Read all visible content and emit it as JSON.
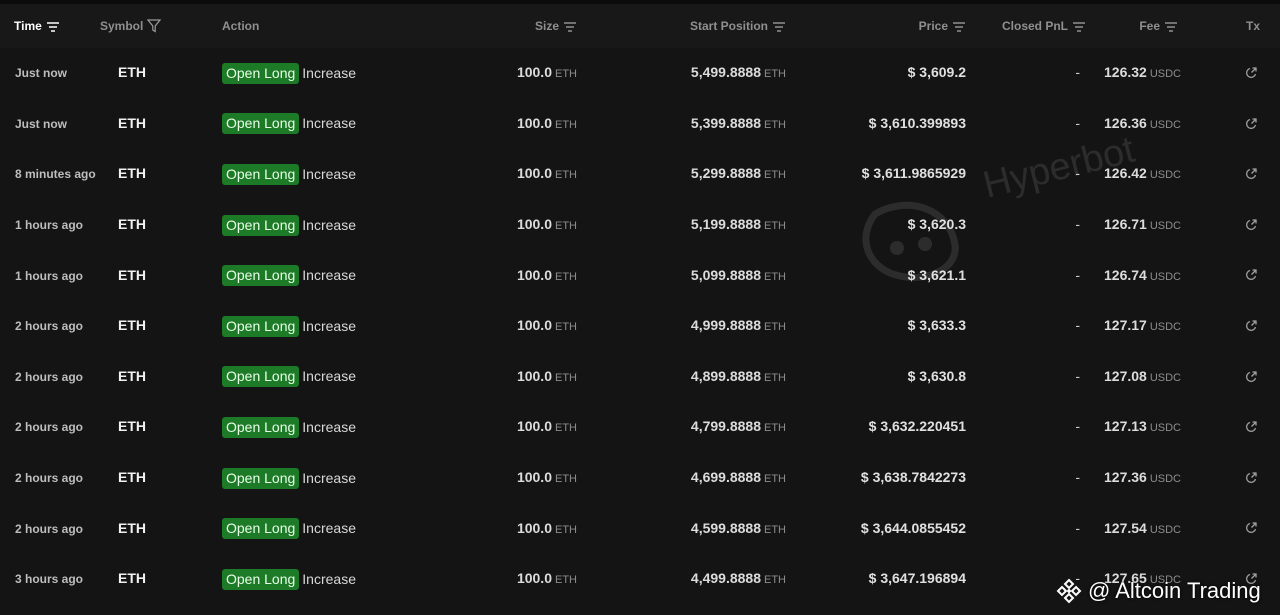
{
  "columns": {
    "time": "Time",
    "symbol": "Symbol",
    "action": "Action",
    "size": "Size",
    "start_position": "Start Position",
    "price": "Price",
    "closed_pnl": "Closed PnL",
    "fee": "Fee",
    "tx": "Tx"
  },
  "units": {
    "eth": "ETH",
    "usdc": "USDC"
  },
  "rows": [
    {
      "time": "Just now",
      "symbol": "ETH",
      "action": "Open Long",
      "detail": "Increase",
      "size": "100.0",
      "start_position": "5,499.8888",
      "price": "$ 3,609.2",
      "closed_pnl": "-",
      "fee": "126.32"
    },
    {
      "time": "Just now",
      "symbol": "ETH",
      "action": "Open Long",
      "detail": "Increase",
      "size": "100.0",
      "start_position": "5,399.8888",
      "price": "$ 3,610.399893",
      "closed_pnl": "-",
      "fee": "126.36"
    },
    {
      "time": "8 minutes ago",
      "symbol": "ETH",
      "action": "Open Long",
      "detail": "Increase",
      "size": "100.0",
      "start_position": "5,299.8888",
      "price": "$ 3,611.9865929",
      "closed_pnl": "-",
      "fee": "126.42"
    },
    {
      "time": "1 hours ago",
      "symbol": "ETH",
      "action": "Open Long",
      "detail": "Increase",
      "size": "100.0",
      "start_position": "5,199.8888",
      "price": "$ 3,620.3",
      "closed_pnl": "-",
      "fee": "126.71"
    },
    {
      "time": "1 hours ago",
      "symbol": "ETH",
      "action": "Open Long",
      "detail": "Increase",
      "size": "100.0",
      "start_position": "5,099.8888",
      "price": "$ 3,621.1",
      "closed_pnl": "-",
      "fee": "126.74"
    },
    {
      "time": "2 hours ago",
      "symbol": "ETH",
      "action": "Open Long",
      "detail": "Increase",
      "size": "100.0",
      "start_position": "4,999.8888",
      "price": "$ 3,633.3",
      "closed_pnl": "-",
      "fee": "127.17"
    },
    {
      "time": "2 hours ago",
      "symbol": "ETH",
      "action": "Open Long",
      "detail": "Increase",
      "size": "100.0",
      "start_position": "4,899.8888",
      "price": "$ 3,630.8",
      "closed_pnl": "-",
      "fee": "127.08"
    },
    {
      "time": "2 hours ago",
      "symbol": "ETH",
      "action": "Open Long",
      "detail": "Increase",
      "size": "100.0",
      "start_position": "4,799.8888",
      "price": "$ 3,632.220451",
      "closed_pnl": "-",
      "fee": "127.13"
    },
    {
      "time": "2 hours ago",
      "symbol": "ETH",
      "action": "Open Long",
      "detail": "Increase",
      "size": "100.0",
      "start_position": "4,699.8888",
      "price": "$ 3,638.7842273",
      "closed_pnl": "-",
      "fee": "127.36"
    },
    {
      "time": "2 hours ago",
      "symbol": "ETH",
      "action": "Open Long",
      "detail": "Increase",
      "size": "100.0",
      "start_position": "4,599.8888",
      "price": "$ 3,644.0855452",
      "closed_pnl": "-",
      "fee": "127.54"
    },
    {
      "time": "3 hours ago",
      "symbol": "ETH",
      "action": "Open Long",
      "detail": "Increase",
      "size": "100.0",
      "start_position": "4,499.8888",
      "price": "$ 3,647.196894",
      "closed_pnl": "-",
      "fee": "127.65"
    }
  ],
  "watermark": {
    "text": "Hyperbot"
  },
  "brand": {
    "text": "@ Altcoin Trading"
  },
  "colors": {
    "badge": "#1d7a27",
    "background": "#141414",
    "header": "#181818"
  },
  "icons": {
    "sort": "sort-lines-icon",
    "filter": "filter-funnel-icon",
    "tx": "external-link-icon"
  }
}
